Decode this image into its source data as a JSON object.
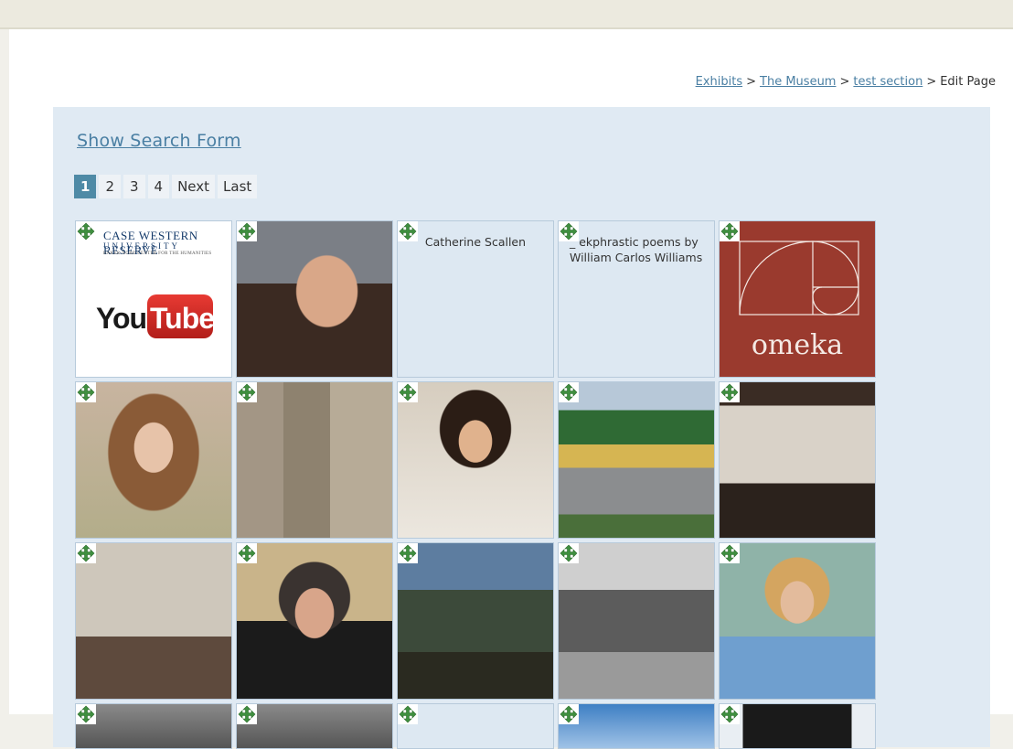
{
  "breadcrumb": {
    "items": [
      "Exhibits",
      "The Museum",
      "test section"
    ],
    "current": "Edit Page",
    "separator": ">"
  },
  "search": {
    "label": "Show Search Form"
  },
  "pagination": {
    "pages": [
      "1",
      "2",
      "3",
      "4"
    ],
    "current": "1",
    "next": "Next",
    "last": "Last"
  },
  "tiles": [
    {
      "kind": "logo",
      "institution": "CASE WESTERN RESERVE",
      "sub": "UNIVERSITY",
      "sub2": "BAKER-NORD CENTER FOR THE HUMANITIES",
      "brand_left": "You",
      "brand_right": "Tube"
    },
    {
      "kind": "photo"
    },
    {
      "kind": "text",
      "caption": "Catherine Scallen"
    },
    {
      "kind": "text",
      "caption": "_ ekphrastic poems by William Carlos Williams"
    },
    {
      "kind": "logo-omeka",
      "word": "omeka"
    },
    {
      "kind": "photo"
    },
    {
      "kind": "photo"
    },
    {
      "kind": "photo"
    },
    {
      "kind": "photo"
    },
    {
      "kind": "photo"
    },
    {
      "kind": "photo"
    },
    {
      "kind": "photo"
    },
    {
      "kind": "photo"
    },
    {
      "kind": "photo"
    },
    {
      "kind": "photo"
    }
  ],
  "colors": {
    "panel": "#e0eaf3",
    "link": "#4a7fa3",
    "current_page": "#4e8aa6",
    "omeka": "#9a3a2e"
  },
  "icons": {
    "move": "move-arrows-icon"
  }
}
